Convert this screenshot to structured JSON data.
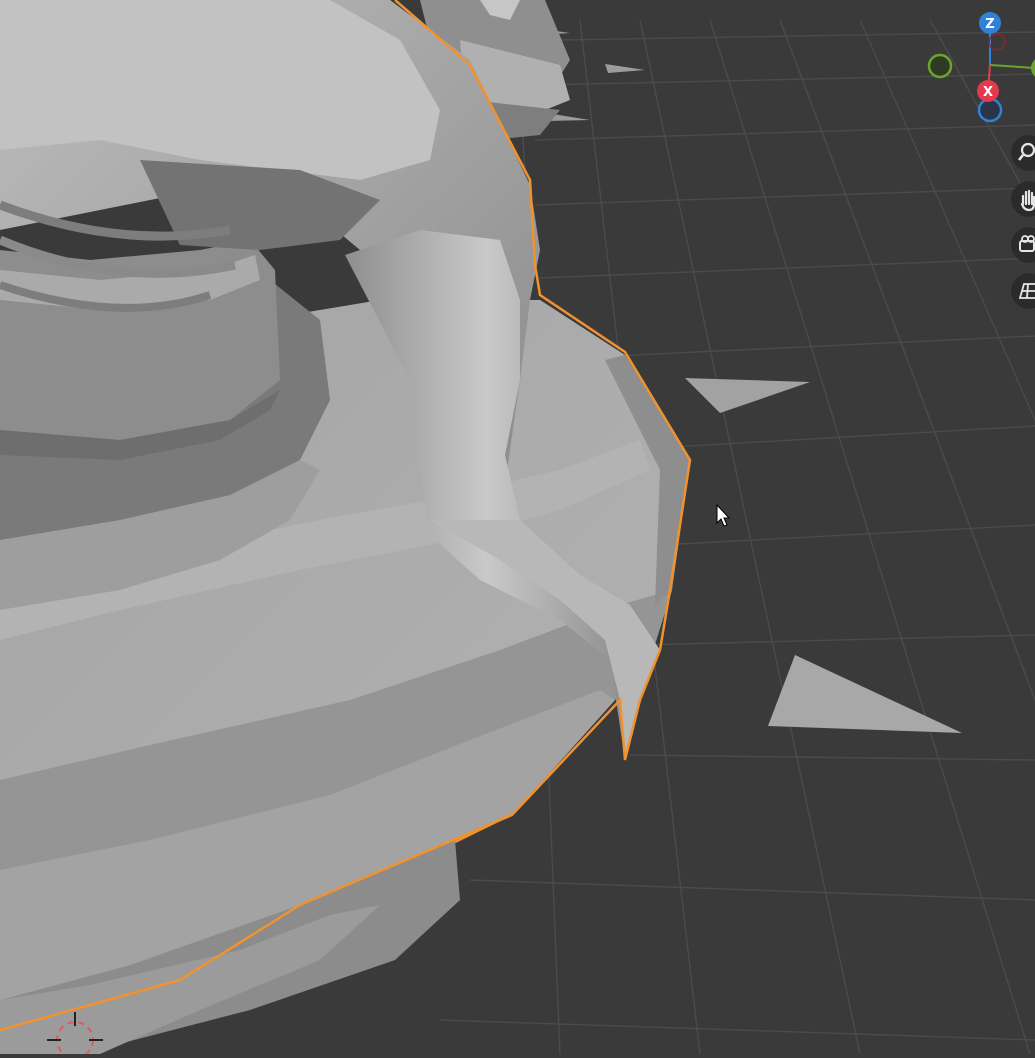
{
  "viewport": {
    "background_color": "#3a3a3a",
    "grid_line_color": "#4d4d4d",
    "mesh_color": "#a6a6a6",
    "selection_outline_color": "#f0922e"
  },
  "gizmo": {
    "z_label": "Z",
    "x_label": "X",
    "z_color": "#2f82d8",
    "x_color": "#e33a4c",
    "y_color": "#6aa52a"
  },
  "nav_buttons": [
    {
      "icon": "zoom-icon"
    },
    {
      "icon": "hand-pan-icon"
    },
    {
      "icon": "camera-icon"
    },
    {
      "icon": "perspective-grid-icon"
    }
  ]
}
